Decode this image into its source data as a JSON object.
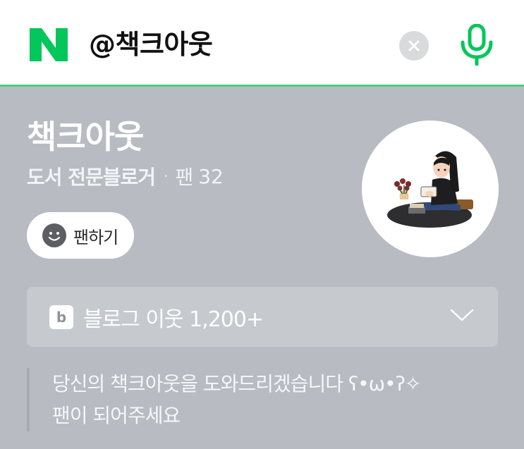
{
  "search": {
    "query": "@책크아웃"
  },
  "profile": {
    "blog_name": "책크아웃",
    "category": "도서 전문블로거",
    "separator": "·",
    "fans_label": "팬",
    "fans_count": "32",
    "fan_button_label": "팬하기"
  },
  "neighbors": {
    "icon_letter": "b",
    "label": "블로그 이웃 1,200+"
  },
  "intro": {
    "line1": "당신의 책크아웃을 도와드리겠습니다 ʕ•ω•ʔ✧",
    "line2": "팬이 되어주세요"
  },
  "colors": {
    "naver_green": "#03c75a",
    "accent_line": "#4bcf7e",
    "panel_bg": "#b8bbc1"
  }
}
